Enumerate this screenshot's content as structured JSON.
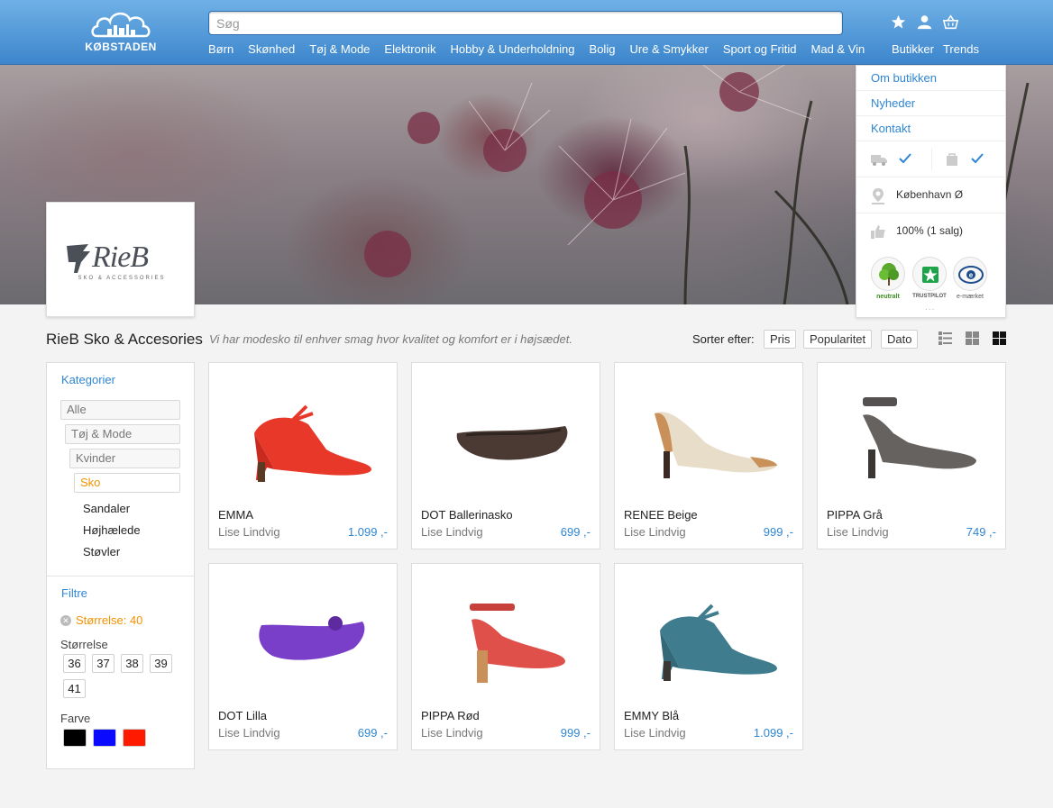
{
  "header": {
    "logo_text": "KØBSTADEN",
    "search_placeholder": "Søg",
    "nav": [
      "Børn",
      "Skønhed",
      "Tøj & Mode",
      "Elektronik",
      "Hobby & Underholdning",
      "Bolig",
      "Ure & Smykker",
      "Sport og Fritid",
      "Mad & Vin"
    ],
    "icons": [
      "star-icon",
      "user-icon",
      "basket-icon"
    ],
    "links": {
      "stores": "Butikker",
      "trends": "Trends"
    }
  },
  "store": {
    "logo_brand": "RieB",
    "logo_sub": "SKO & ACCESSORIES",
    "name": "RieB Sko & Accesories",
    "tagline": "Vi har modesko til enhver smag hvor kvalitet og komfort er i højsædet."
  },
  "store_panel": {
    "links": [
      "Om butikken",
      "Nyheder",
      "Kontakt"
    ],
    "location": "København Ø",
    "rating": "100% (1 salg)",
    "badges": [
      {
        "label": "neutralt",
        "icon": "tree-icon"
      },
      {
        "label": "TRUSTPILOT",
        "icon": "trustpilot-star-icon"
      },
      {
        "label": "e-mærket",
        "icon": "e-maerket-icon"
      }
    ],
    "more": "..."
  },
  "sort": {
    "label": "Sorter efter:",
    "options": [
      "Pris",
      "Popularitet",
      "Dato"
    ],
    "views": [
      "list-view-icon",
      "grid-small-view-icon",
      "grid-large-view-icon"
    ]
  },
  "sidebar": {
    "categories_title": "Kategorier",
    "category_path": [
      "Alle",
      "Tøj & Mode",
      "Kvinder",
      "Sko"
    ],
    "subcategories": [
      "Sandaler",
      "Højhælede",
      "Støvler"
    ],
    "filters_title": "Filtre",
    "active_filter": "Størrelse: 40",
    "size_label": "Størrelse",
    "sizes": [
      "36",
      "37",
      "38",
      "39",
      "41"
    ],
    "color_label": "Farve",
    "colors": [
      "#000000",
      "#0a0aff",
      "#ff1a00"
    ]
  },
  "products": [
    {
      "name": "EMMA",
      "seller": "Lise Lindvig",
      "price": "1.099 ,-",
      "color": "#e8382a"
    },
    {
      "name": "DOT Ballerinasko",
      "seller": "Lise Lindvig",
      "price": "699 ,-",
      "color": "#4a3a33"
    },
    {
      "name": "RENEE Beige",
      "seller": "Lise Lindvig",
      "price": "999 ,-",
      "color": "#e8ddc9"
    },
    {
      "name": "PIPPA Grå",
      "seller": "Lise Lindvig",
      "price": "749 ,-",
      "color": "#666260"
    },
    {
      "name": "DOT Lilla",
      "seller": "Lise Lindvig",
      "price": "699 ,-",
      "color": "#7a3fc8"
    },
    {
      "name": "PIPPA Rød",
      "seller": "Lise Lindvig",
      "price": "999 ,-",
      "color": "#e0504a"
    },
    {
      "name": "EMMY Blå",
      "seller": "Lise Lindvig",
      "price": "1.099 ,-",
      "color": "#3f7d8e"
    }
  ]
}
